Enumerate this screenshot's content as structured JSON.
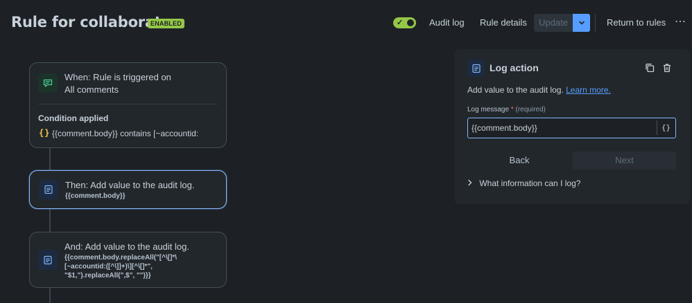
{
  "header": {
    "title": "Rule for collaborates",
    "status_badge": "ENABLED",
    "audit_log_label": "Audit log",
    "rule_details_label": "Rule details",
    "update_label": "Update",
    "return_label": "Return to rules",
    "enabled": true
  },
  "flow": {
    "trigger": {
      "title": "When: Rule is triggered on",
      "subtitle": "All comments",
      "condition_heading": "Condition applied",
      "condition_icon": "{}",
      "condition_text": "{{comment.body}} contains [~accountid:"
    },
    "step1": {
      "title": "Then: Add value to the audit log.",
      "code": "{{comment.body}}"
    },
    "step2": {
      "title": "And: Add value to the audit log.",
      "code_lines": [
        "{{comment.body.replaceAll(\"[^\\[]*\\",
        "[~accountid:([^\\]]+)\\][^\\[]*\",",
        "\"$1,\").replaceAll(\",$\", \"\")}}"
      ]
    }
  },
  "panel": {
    "title": "Log action",
    "description": "Add value to the audit log.",
    "learn_more": "Learn more.",
    "field_label": "Log message",
    "required_mark": "*",
    "required_hint": "(required)",
    "field_value": "{{comment.body}}",
    "smart_value_button": "{}",
    "back_label": "Back",
    "next_label": "Next",
    "expander_label": "What information can I log?"
  },
  "colors": {
    "background": "#1d2125",
    "accent": "#579dff",
    "enabled": "#94c748",
    "selected_border": "#85b8ff"
  },
  "icons": {
    "toggle": "check-icon",
    "update_caret": "chevron-down-icon",
    "more": "more-icon",
    "trigger": "comment-icon",
    "action": "log-icon",
    "copy": "copy-icon",
    "delete": "trash-icon",
    "expander": "chevron-right-icon"
  }
}
